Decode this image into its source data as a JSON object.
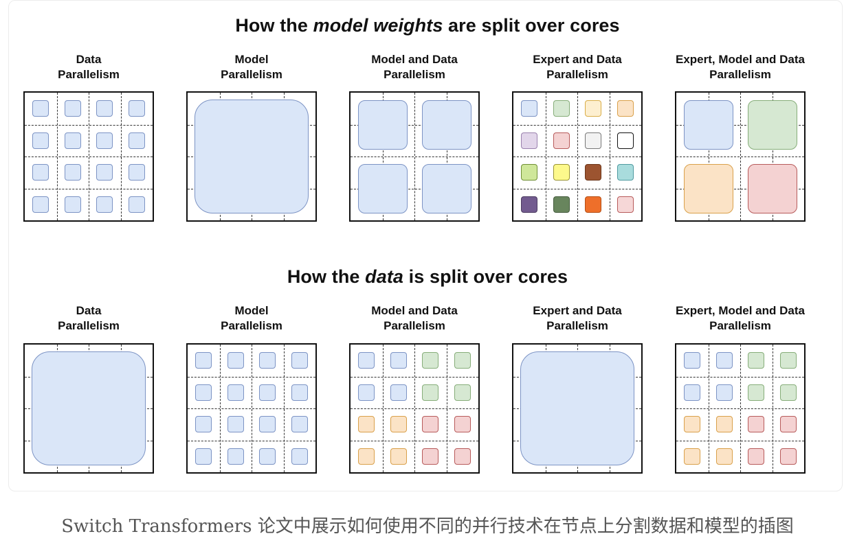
{
  "sections": {
    "weights": {
      "title_prefix": "How the ",
      "title_em": "model weights",
      "title_suffix": " are split over cores"
    },
    "data": {
      "title_prefix": "How the ",
      "title_em": "data",
      "title_suffix": " is split over cores"
    }
  },
  "panel_labels": [
    [
      "Data",
      "Parallelism"
    ],
    [
      "Model",
      "Parallelism"
    ],
    [
      "Model and Data",
      "Parallelism"
    ],
    [
      "Expert and Data",
      "Parallelism"
    ],
    [
      "Expert, Model and Data",
      "Parallelism"
    ]
  ],
  "colors": {
    "blue": {
      "fill": "#dae6f8",
      "stroke": "#7c93c4"
    },
    "green": {
      "fill": "#d6e8d2",
      "stroke": "#86ad79"
    },
    "yellow": {
      "fill": "#fdefd0",
      "stroke": "#d9ad47"
    },
    "red": {
      "fill": "#f4d2d2",
      "stroke": "#b75a5a"
    },
    "peach": {
      "fill": "#fbe3c6",
      "stroke": "#d9a04a"
    },
    "lavender": {
      "fill": "#e2d6ea",
      "stroke": "#9a80ad"
    },
    "lightgray": {
      "fill": "#f2f2f2",
      "stroke": "#777777"
    },
    "white": {
      "fill": "#ffffff",
      "stroke": "#111111"
    },
    "lime": {
      "fill": "#cfe79a",
      "stroke": "#6f8f34"
    },
    "lightyellow": {
      "fill": "#fdf98c",
      "stroke": "#999333"
    },
    "brown": {
      "fill": "#9c5430",
      "stroke": "#6b3418"
    },
    "teal": {
      "fill": "#a9dcdd",
      "stroke": "#4f9aa0"
    },
    "purple": {
      "fill": "#725b8f",
      "stroke": "#4b3a60"
    },
    "darkgreen": {
      "fill": "#68855d",
      "stroke": "#465c3e"
    },
    "orange": {
      "fill": "#ee6f2a",
      "stroke": "#b44e15"
    },
    "pink": {
      "fill": "#f6d7d7",
      "stroke": "#b75a5a"
    }
  },
  "rows": {
    "weights": [
      {
        "kind": "cells",
        "colors": [
          "blue",
          "blue",
          "blue",
          "blue",
          "blue",
          "blue",
          "blue",
          "blue",
          "blue",
          "blue",
          "blue",
          "blue",
          "blue",
          "blue",
          "blue",
          "blue"
        ]
      },
      {
        "kind": "full",
        "color": "blue"
      },
      {
        "kind": "quads",
        "colors": [
          "blue",
          "blue",
          "blue",
          "blue"
        ]
      },
      {
        "kind": "cells",
        "colors": [
          "blue",
          "green",
          "yellow",
          "peach",
          "lavender",
          "red",
          "lightgray",
          "white",
          "lime",
          "lightyellow",
          "brown",
          "teal",
          "purple",
          "darkgreen",
          "orange",
          "pink"
        ]
      },
      {
        "kind": "quads",
        "colors": [
          "blue",
          "green",
          "peach",
          "red"
        ]
      }
    ],
    "data": [
      {
        "kind": "full",
        "color": "blue"
      },
      {
        "kind": "cells",
        "colors": [
          "blue",
          "blue",
          "blue",
          "blue",
          "blue",
          "blue",
          "blue",
          "blue",
          "blue",
          "blue",
          "blue",
          "blue",
          "blue",
          "blue",
          "blue",
          "blue"
        ]
      },
      {
        "kind": "cells",
        "colors": [
          "blue",
          "blue",
          "green",
          "green",
          "blue",
          "blue",
          "green",
          "green",
          "peach",
          "peach",
          "red",
          "red",
          "peach",
          "peach",
          "red",
          "red"
        ]
      },
      {
        "kind": "full",
        "color": "blue"
      },
      {
        "kind": "cells",
        "colors": [
          "blue",
          "blue",
          "green",
          "green",
          "blue",
          "blue",
          "green",
          "green",
          "peach",
          "peach",
          "red",
          "red",
          "peach",
          "peach",
          "red",
          "red"
        ]
      }
    ]
  },
  "caption": "Switch Transformers 论文中展示如何使用不同的并行技术在节点上分割数据和模型的插图"
}
